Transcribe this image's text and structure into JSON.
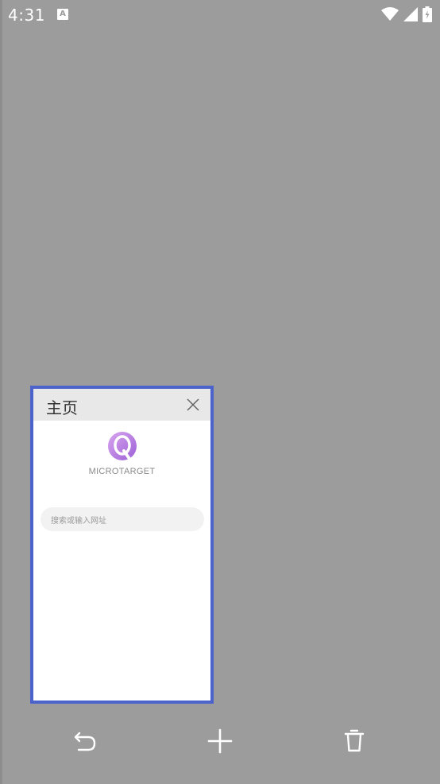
{
  "status_bar": {
    "time": "4:31",
    "notification_icon": "a-icon",
    "icons": [
      "wifi-icon",
      "signal-icon",
      "battery-charging-icon"
    ]
  },
  "tab_card": {
    "title": "主页",
    "brand_text": "MICROTARGET",
    "search_placeholder": "搜索或输入网址",
    "border_color": "#4b63cb"
  },
  "bottom_bar": {
    "icons": [
      "undo-icon",
      "add-icon",
      "trash-icon"
    ]
  }
}
